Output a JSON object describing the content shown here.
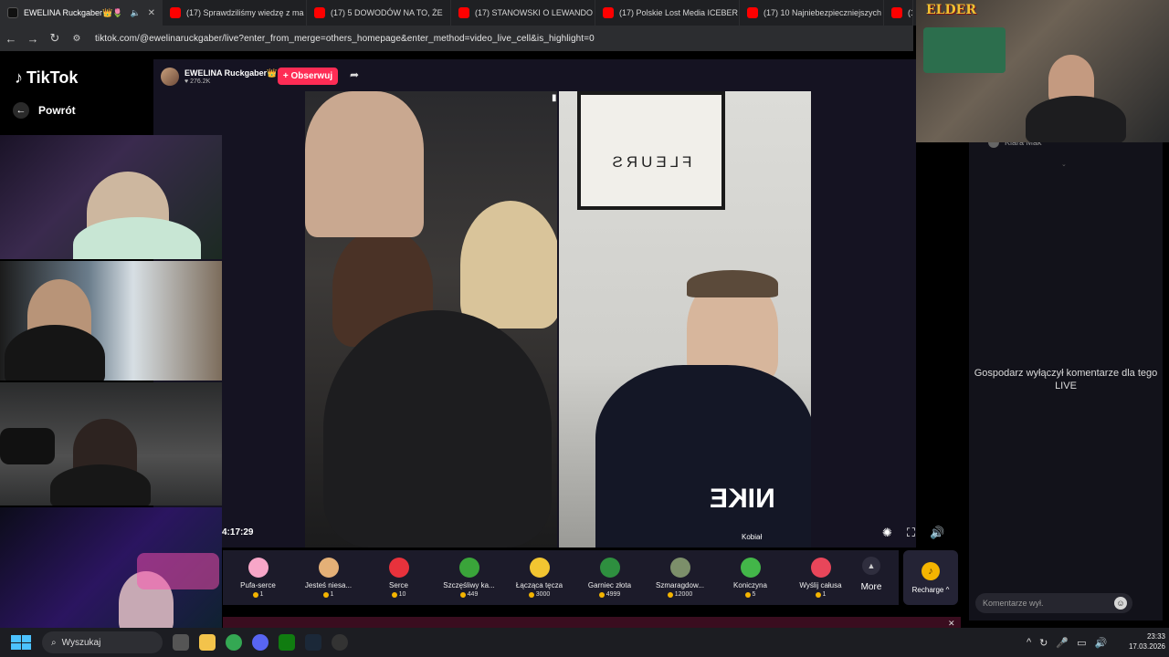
{
  "browser": {
    "tabs": [
      {
        "label": "EWELINA Ruckgaber👑🌷",
        "active": true,
        "fav_color": "#111111"
      },
      {
        "label": "(17) Sprawdziliśmy wiedzę z ma",
        "fav_color": "#ff0000"
      },
      {
        "label": "(17) 5 DOWODÓW NA TO, ŻE",
        "fav_color": "#ff0000"
      },
      {
        "label": "(17) STANOWSKI O LEWANDO",
        "fav_color": "#ff0000"
      },
      {
        "label": "(17) Polskie Lost Media ICEBER",
        "fav_color": "#ff0000"
      },
      {
        "label": "(17) 10 Najniebezpieczniejszych",
        "fav_color": "#ff0000"
      },
      {
        "label": "(1",
        "fav_color": "#ff0000"
      }
    ],
    "close_glyph": "✕",
    "url": "tiktok.com/@ewelinaruckgaber/live?enter_from_merge=others_homepage&enter_method=video_live_cell&is_highlight=0"
  },
  "tiktok": {
    "logo_text": "TikTok",
    "back_label": "Powrót",
    "host": {
      "name": "EWELINA Ruckgaber👑 –",
      "likes": "♥ 276.2K"
    },
    "follow_label": "+ Obserwuj",
    "timer": "4:17:29",
    "poster_text": "FLEURS",
    "watermark": "Kobiał",
    "gifts": [
      {
        "name": "Pufa-serce",
        "price": "1",
        "color": "#f7a6c8"
      },
      {
        "name": "Jesteś niesa...",
        "price": "1",
        "color": "#e4b077"
      },
      {
        "name": "Serce",
        "price": "10",
        "color": "#e8323c"
      },
      {
        "name": "Szczęśliwy ka...",
        "price": "449",
        "color": "#3aa43a"
      },
      {
        "name": "Łącząca tęcza",
        "price": "3000",
        "color": "#f2c531"
      },
      {
        "name": "Garniec złota",
        "price": "4999",
        "color": "#2e8f3f"
      },
      {
        "name": "Szmaragdow...",
        "price": "12000",
        "color": "#7c8f6a"
      },
      {
        "name": "Koniczyna",
        "price": "5",
        "color": "#43b649"
      },
      {
        "name": "Wyślij całusa",
        "price": "1",
        "color": "#e8465a"
      }
    ],
    "more_label": "More",
    "recharge_label": "Recharge ^",
    "chat": {
      "user": "Klara Mak",
      "disabled_message": "Gospodarz wyłączył komentarze dla tego LIVE",
      "comment_placeholder": "Komentarze wył."
    }
  },
  "overlay": {
    "streamer_logo": "ELDER"
  },
  "taskbar": {
    "search_label": "Wyszukaj",
    "time": "23:33",
    "date": "17.03.2026",
    "apps": [
      {
        "name": "file-explorer",
        "color": "#f3c34b"
      },
      {
        "name": "chrome",
        "color": "#34a853"
      },
      {
        "name": "discord",
        "color": "#5865f2"
      },
      {
        "name": "xbox",
        "color": "#107c10"
      },
      {
        "name": "steam",
        "color": "#1b2838"
      },
      {
        "name": "obs",
        "color": "#333333"
      }
    ]
  }
}
